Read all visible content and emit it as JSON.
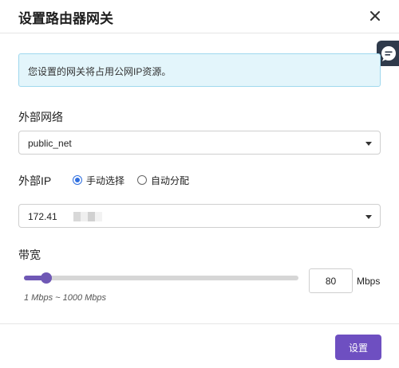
{
  "dialog": {
    "title": "设置路由器网关",
    "info_message": "您设置的网关将占用公网IP资源。"
  },
  "external_network": {
    "label": "外部网络",
    "selected": "public_net"
  },
  "external_ip": {
    "label": "外部IP",
    "mode_options": [
      {
        "label": "手动选择",
        "selected": true
      },
      {
        "label": "自动分配",
        "selected": false
      }
    ],
    "selected_prefix": "172.41"
  },
  "bandwidth": {
    "label": "带宽",
    "value": "80",
    "unit": "Mbps",
    "range_hint": "1 Mbps ~ 1000 Mbps",
    "level_fraction": 0.08
  },
  "actions": {
    "submit_label": "设置"
  },
  "colors": {
    "accent": "#6e4fc1",
    "info_bg": "#e3f5fb",
    "radio_selected": "#2f6fe0",
    "side_tab": "#2f3a4b"
  },
  "icons": {
    "close": "close-icon",
    "feedback": "chat-bubble-icon",
    "dropdown": "caret-down-icon"
  }
}
